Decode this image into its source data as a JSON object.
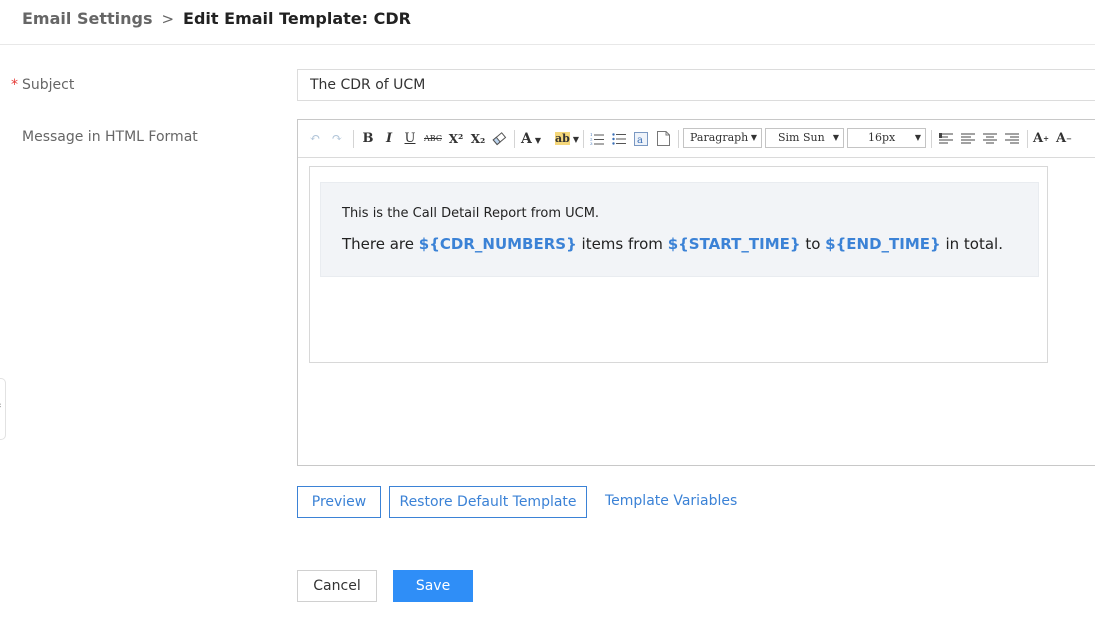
{
  "breadcrumb": {
    "parent": "Email Settings",
    "separator": ">",
    "current": "Edit Email Template: CDR"
  },
  "form": {
    "subject_required_mark": "*",
    "subject_label": "Subject",
    "subject_value": "The CDR of UCM",
    "message_label": "Message in HTML Format"
  },
  "toolbar": {
    "undo": "↶",
    "redo": "↷",
    "bold": "B",
    "italic": "I",
    "underline": "U",
    "strikethrough": "ABC",
    "superscript": "X²",
    "subscript": "X₂",
    "font_color": "A",
    "highlight": "ab",
    "paragraph_select": "Paragraph",
    "font_family_select": "Sim Sun",
    "font_size_select": "16px",
    "font_increase": "A",
    "font_decrease": "A"
  },
  "content": {
    "line1": "This is the Call Detail Report from UCM.",
    "line2": {
      "t1": "There are ",
      "v1": "${CDR_NUMBERS}",
      "t2": " items from ",
      "v2": "${START_TIME}",
      "t3": " to ",
      "v3": "${END_TIME}",
      "t4": " in total."
    }
  },
  "actions": {
    "preview": "Preview",
    "restore": "Restore Default Template",
    "variables": "Template Variables",
    "cancel": "Cancel",
    "save": "Save"
  },
  "colors": {
    "accent": "#3b82d6",
    "primary_button": "#2f8ef7",
    "required": "#e53935"
  }
}
